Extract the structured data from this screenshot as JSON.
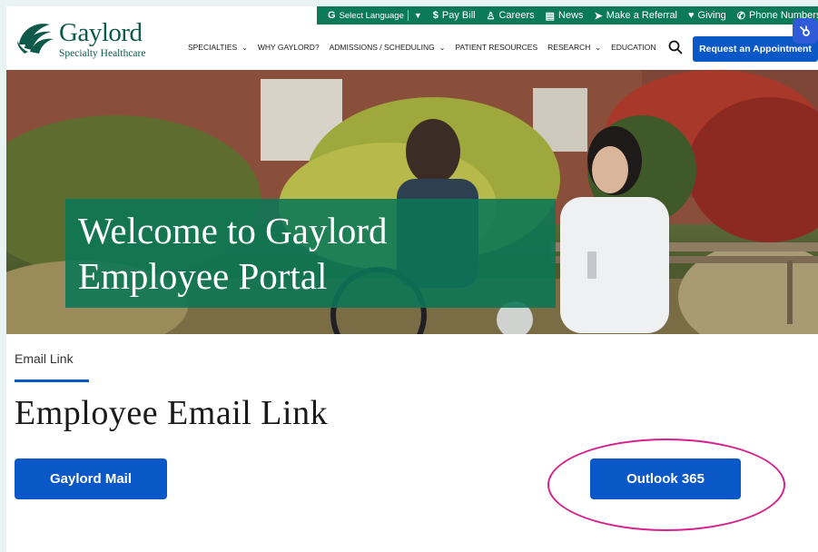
{
  "utility_bar": {
    "language_label": "Select Language",
    "language_caret": "▼",
    "items": [
      {
        "icon": "dollar-icon",
        "glyph": "$",
        "label": "Pay Bill"
      },
      {
        "icon": "person-icon",
        "glyph": "♙",
        "label": "Careers"
      },
      {
        "icon": "news-icon",
        "glyph": "▤",
        "label": "News"
      },
      {
        "icon": "send-icon",
        "glyph": "➤",
        "label": "Make a Referral"
      },
      {
        "icon": "giving-icon",
        "glyph": "♥",
        "label": "Giving"
      },
      {
        "icon": "phone-icon",
        "glyph": "✆",
        "label": "Phone Numbers"
      }
    ]
  },
  "logo": {
    "brand": "Gaylord",
    "subtitle": "Specialty Healthcare"
  },
  "nav": {
    "items": [
      {
        "label": "SPECIALTIES",
        "dropdown": true
      },
      {
        "label": "WHY GAYLORD?",
        "dropdown": false
      },
      {
        "label": "ADMISSIONS / SCHEDULING",
        "dropdown": true
      },
      {
        "label": "PATIENT RESOURCES",
        "dropdown": false
      },
      {
        "label": "RESEARCH",
        "dropdown": true
      },
      {
        "label": "EDUCATION",
        "dropdown": false
      }
    ],
    "cta_label": "Request an Appointment"
  },
  "hero": {
    "title": "Welcome to Gaylord Employee Portal"
  },
  "content": {
    "breadcrumb": "Email Link",
    "page_title": "Employee Email Link",
    "buttons": {
      "gaylord_mail": "Gaylord Mail",
      "outlook": "Outlook 365"
    }
  },
  "colors": {
    "brand_green": "#0b7a56",
    "cta_blue": "#0a57c7",
    "annotation_pink": "#d6218e"
  }
}
